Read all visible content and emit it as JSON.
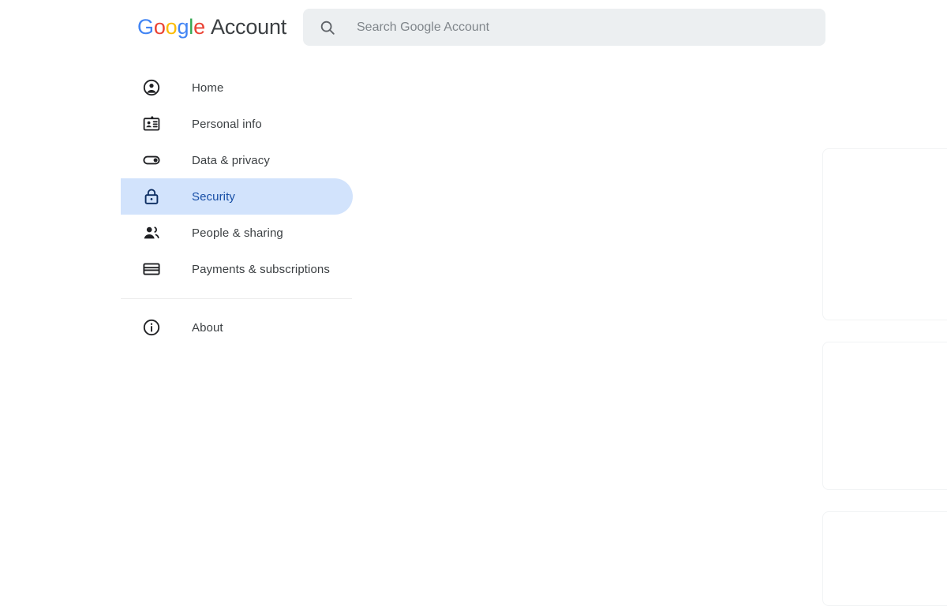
{
  "header": {
    "brand": {
      "logo_letters": [
        "G",
        "o",
        "o",
        "g",
        "l",
        "e"
      ],
      "product_word": "Account"
    },
    "search": {
      "icon": "search-icon",
      "placeholder": "Search Google Account",
      "value": ""
    }
  },
  "sidebar": {
    "items": [
      {
        "id": "home",
        "label": "Home",
        "icon": "account-circle-icon",
        "active": false
      },
      {
        "id": "personal-info",
        "label": "Personal info",
        "icon": "id-card-icon",
        "active": false
      },
      {
        "id": "data-privacy",
        "label": "Data & privacy",
        "icon": "toggle-on-icon",
        "active": false
      },
      {
        "id": "security",
        "label": "Security",
        "icon": "lock-icon",
        "active": true
      },
      {
        "id": "people-sharing",
        "label": "People & sharing",
        "icon": "people-icon",
        "active": false
      },
      {
        "id": "payments-subscriptions",
        "label": "Payments & subscriptions",
        "icon": "credit-card-icon",
        "active": false
      }
    ],
    "footer_items": [
      {
        "id": "about",
        "label": "About",
        "icon": "info-circle-icon",
        "active": false
      }
    ]
  },
  "colors": {
    "active_pill_background": "#d2e3fc",
    "active_text": "#174ea6",
    "search_background": "#eceff1",
    "text_primary": "#3c4043",
    "placeholder": "#80868b",
    "divider": "#ececec",
    "card_border": "#f1f3f4",
    "google_blue": "#4285f4",
    "google_red": "#ea4335",
    "google_yellow": "#fbbc05",
    "google_green": "#34a853"
  }
}
